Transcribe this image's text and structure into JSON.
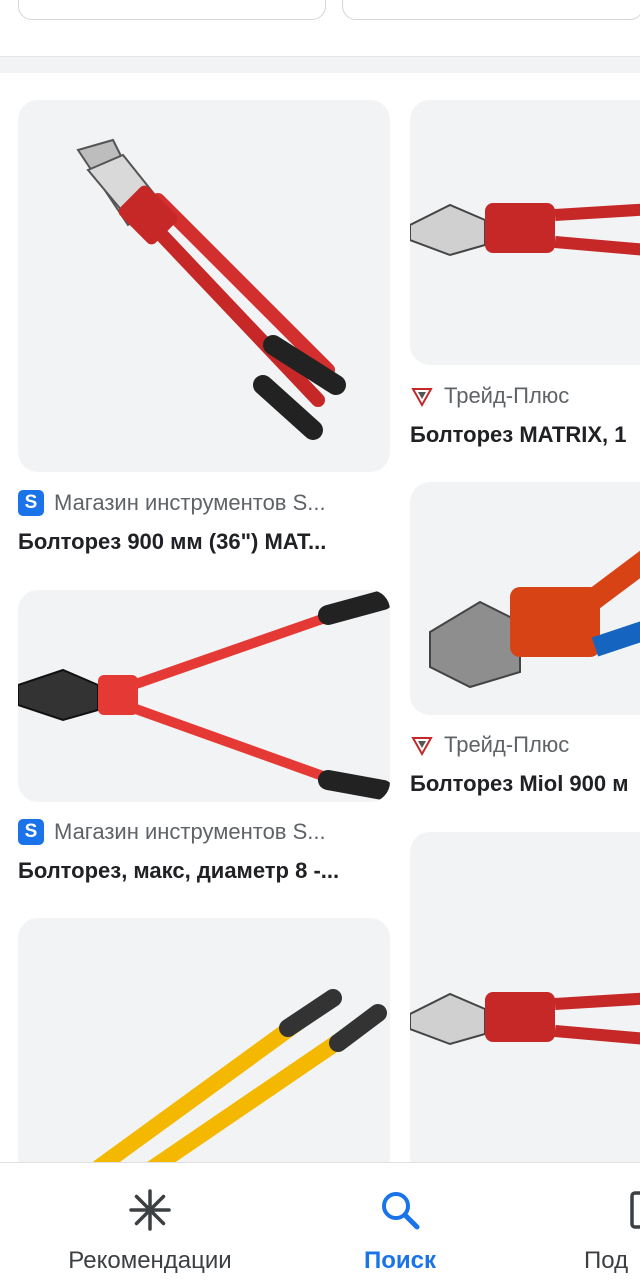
{
  "results": [
    {
      "source": "Магазин инструментов S...",
      "favicon": "S",
      "title": "Болторез 900 мм (36\") MAT..."
    },
    {
      "source": "Трейд-Плюс",
      "favicon": "trade-plus",
      "title": "Болторез MATRIX, 1"
    },
    {
      "source": "Магазин инструментов S...",
      "favicon": "S",
      "title": "Болторез, макс, диаметр 8 -..."
    },
    {
      "source": "Трейд-Плюс",
      "favicon": "trade-plus",
      "title": "Болторез Miol 900 м"
    }
  ],
  "nav": {
    "recommendations": "Рекомендации",
    "search": "Поиск",
    "subscriptions": "Под"
  },
  "colors": {
    "accent": "#1a73e8",
    "tool_red": "#d32f2f",
    "tool_yellow": "#f5b800"
  }
}
